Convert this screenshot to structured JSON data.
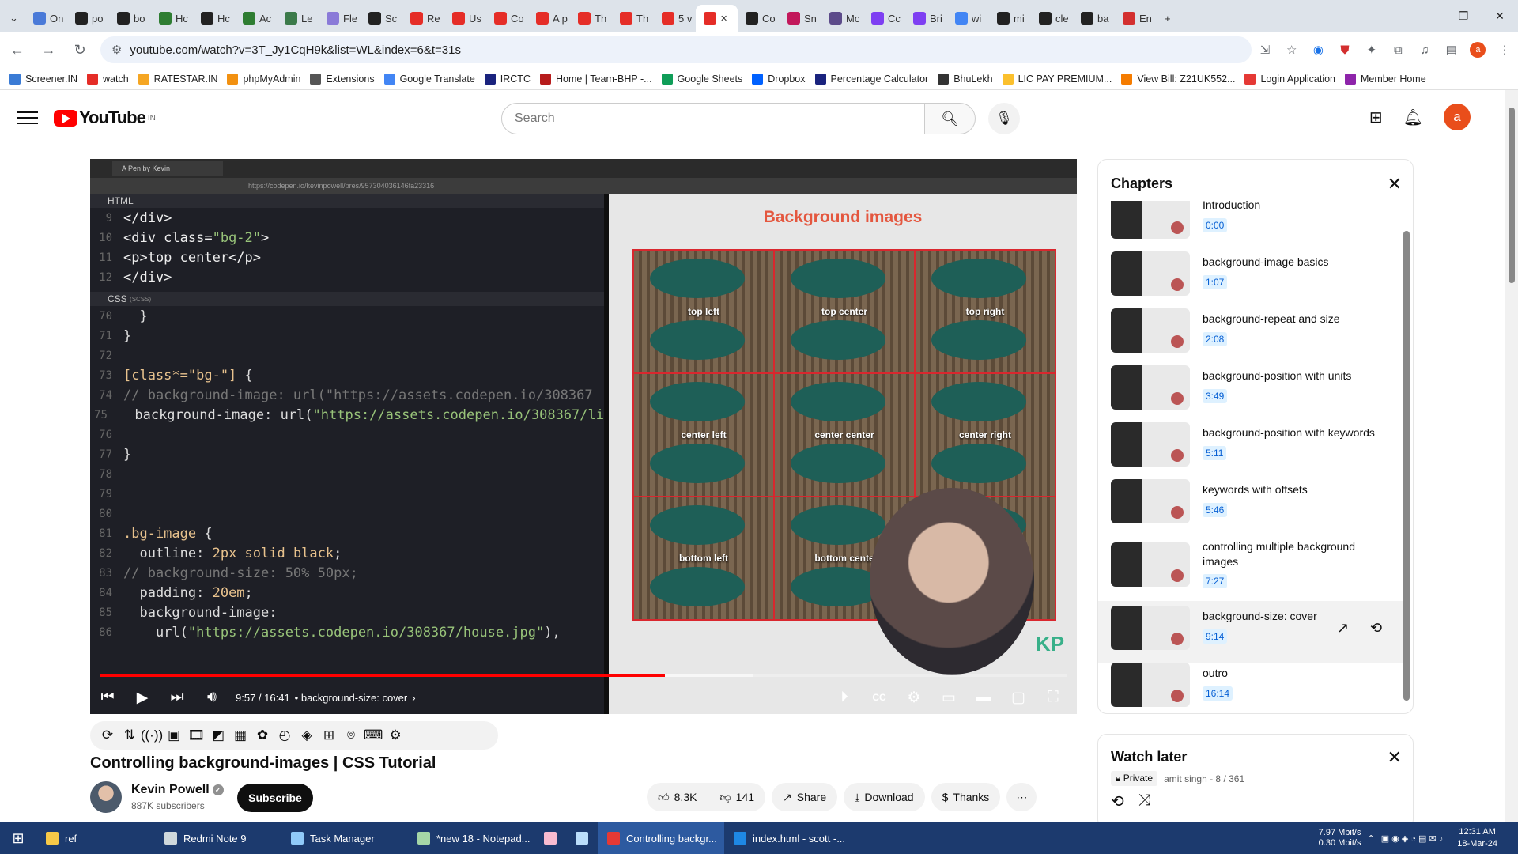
{
  "browser": {
    "tabs": [
      {
        "label": "On",
        "color": "#4a7ad8"
      },
      {
        "label": "po",
        "color": "#222"
      },
      {
        "label": "bo",
        "color": "#222"
      },
      {
        "label": "Hc",
        "color": "#2e7d32"
      },
      {
        "label": "Hc",
        "color": "#222"
      },
      {
        "label": "Ac",
        "color": "#2e7d32"
      },
      {
        "label": "Le",
        "color": "#3b7a4a"
      },
      {
        "label": "Fle",
        "color": "#8a7ad8"
      },
      {
        "label": "Sc",
        "color": "#222"
      },
      {
        "label": "Re",
        "color": "#e52d27"
      },
      {
        "label": "Us",
        "color": "#e52d27"
      },
      {
        "label": "Co",
        "color": "#e52d27"
      },
      {
        "label": "A p",
        "color": "#e52d27"
      },
      {
        "label": "Th",
        "color": "#e52d27"
      },
      {
        "label": "Th",
        "color": "#e52d27"
      },
      {
        "label": "5 v",
        "color": "#e52d27"
      },
      {
        "label": "",
        "color": "#e52d27",
        "active": true
      },
      {
        "label": "Co",
        "color": "#222"
      },
      {
        "label": "Sn",
        "color": "#c2185b"
      },
      {
        "label": "Mc",
        "color": "#5c4b8a"
      },
      {
        "label": "Cc",
        "color": "#7e3ff2"
      },
      {
        "label": "Bri",
        "color": "#7e3ff2"
      },
      {
        "label": "wi",
        "color": "#4285f4"
      },
      {
        "label": "mi",
        "color": "#222"
      },
      {
        "label": "cle",
        "color": "#222"
      },
      {
        "label": "ba",
        "color": "#222"
      },
      {
        "label": "En",
        "color": "#d32f2f"
      }
    ],
    "url": "youtube.com/watch?v=3T_Jy1CqH9k&list=WL&index=6&t=31s",
    "bookmarks": [
      {
        "label": "Screener.IN",
        "color": "#3a7bd5"
      },
      {
        "label": "watch",
        "color": "#e52d27"
      },
      {
        "label": "RATESTAR.IN",
        "color": "#f5a623"
      },
      {
        "label": "phpMyAdmin",
        "color": "#f29111"
      },
      {
        "label": "Extensions",
        "color": "#555"
      },
      {
        "label": "Google Translate",
        "color": "#4285f4"
      },
      {
        "label": "IRCTC",
        "color": "#1a237e"
      },
      {
        "label": "Home | Team-BHP -...",
        "color": "#b71c1c"
      },
      {
        "label": "Google Sheets",
        "color": "#0f9d58"
      },
      {
        "label": "Dropbox",
        "color": "#0061ff"
      },
      {
        "label": "Percentage Calculator",
        "color": "#1a237e"
      },
      {
        "label": "BhuLekh",
        "color": "#333"
      },
      {
        "label": "LIC PAY PREMIUM...",
        "color": "#fbc02d"
      },
      {
        "label": "View Bill: Z21UK552...",
        "color": "#f57c00"
      },
      {
        "label": "Login Application",
        "color": "#e53935"
      },
      {
        "label": "Member Home",
        "color": "#8e24aa"
      }
    ]
  },
  "youtube": {
    "logo_text": "YouTube",
    "region": "IN",
    "search_placeholder": "Search",
    "avatar_letter": "a"
  },
  "player": {
    "inner_tab_title": "A Pen by Kevin",
    "inner_url": "https://codepen.io/kevinpowell/pres/957304036146fa23316",
    "html_panel_label": "HTML",
    "css_panel_label": "CSS",
    "css_panel_sub": "(SCSS)",
    "preview_title": "Background images",
    "cells": [
      "top left",
      "top center",
      "top right",
      "center left",
      "center center",
      "center right",
      "bottom left",
      "bottom cente",
      ""
    ],
    "watermark": "KP",
    "time_current": "9:57",
    "time_total": "16:41",
    "time_text": "9:57 / 16:41",
    "chapter_label": "• background-size: cover",
    "progress_fraction": 0.584,
    "buffered_fraction": 0.675
  },
  "video": {
    "title": "Controlling background-images | CSS Tutorial",
    "channel": "Kevin Powell",
    "subscribers": "887K subscribers",
    "subscribe_label": "Subscribe",
    "likes": "8.3K",
    "dislikes": "141",
    "share_label": "Share",
    "download_label": "Download",
    "thanks_label": "Thanks"
  },
  "chapters": {
    "heading": "Chapters",
    "items": [
      {
        "title": "Introduction",
        "time": "0:00"
      },
      {
        "title": "background-image basics",
        "time": "1:07"
      },
      {
        "title": "background-repeat and size",
        "time": "2:08"
      },
      {
        "title": "background-position with units",
        "time": "3:49"
      },
      {
        "title": "background-position with keywords",
        "time": "5:11"
      },
      {
        "title": "keywords with offsets",
        "time": "5:46"
      },
      {
        "title": "controlling multiple background images",
        "time": "7:27"
      },
      {
        "title": "background-size: cover",
        "time": "9:14",
        "active": true
      },
      {
        "title": "outro",
        "time": "16:14"
      }
    ]
  },
  "watch_later": {
    "heading": "Watch later",
    "privacy": "Private",
    "meta": "amit singh - 8 / 361"
  },
  "taskbar": {
    "items": [
      {
        "label": "ref",
        "color": "#f7c948"
      },
      {
        "label": "Redmi Note 9",
        "color": "#cfd8dc"
      },
      {
        "label": "Task Manager",
        "color": "#90caf9"
      },
      {
        "label": "*new 18 - Notepad...",
        "color": "#a5d6a7"
      },
      {
        "label": "",
        "color": "#f8bbd0"
      },
      {
        "label": "",
        "color": "#bbdefb"
      },
      {
        "label": "Controlling backgr...",
        "color": "#e53935",
        "active": true
      },
      {
        "label": "index.html - scott -...",
        "color": "#1e88e5"
      }
    ],
    "net_up": "7.97 Mbit/s",
    "net_down": "0.30 Mbit/s",
    "time": "12:31 AM",
    "date": "18-Mar-24"
  }
}
